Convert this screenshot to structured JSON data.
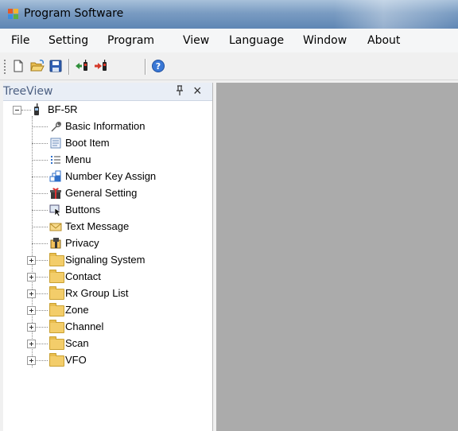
{
  "window": {
    "title": "Program Software"
  },
  "menu": [
    "File",
    "Setting",
    "Program",
    "View",
    "Language",
    "Window",
    "About"
  ],
  "toolbar": {
    "buttons": [
      "new-file-icon",
      "open-folder-icon",
      "save-icon",
      "read-from-radio-icon",
      "write-to-radio-icon",
      "help-icon"
    ]
  },
  "treeview": {
    "title": "TreeView",
    "root": "BF-5R",
    "items": [
      {
        "label": "Basic Information",
        "icon": "wrench-icon"
      },
      {
        "label": "Boot Item",
        "icon": "document-icon"
      },
      {
        "label": "Menu",
        "icon": "list-icon"
      },
      {
        "label": "Number Key Assign",
        "icon": "keypad-icon"
      },
      {
        "label": "General Setting",
        "icon": "gift-icon"
      },
      {
        "label": "Buttons",
        "icon": "cursor-icon"
      },
      {
        "label": "Text Message",
        "icon": "envelope-icon"
      },
      {
        "label": "Privacy",
        "icon": "lock-icon"
      }
    ],
    "folders": [
      {
        "label": "Signaling System"
      },
      {
        "label": "Contact"
      },
      {
        "label": "Rx Group List"
      },
      {
        "label": "Zone"
      },
      {
        "label": "Channel"
      },
      {
        "label": "Scan"
      },
      {
        "label": "VFO"
      }
    ]
  },
  "colors": {
    "titlebar": "#7a9cc2",
    "workspace": "#ababab",
    "tree_header_text": "#4d6082",
    "folder": "#f3cd6a"
  }
}
